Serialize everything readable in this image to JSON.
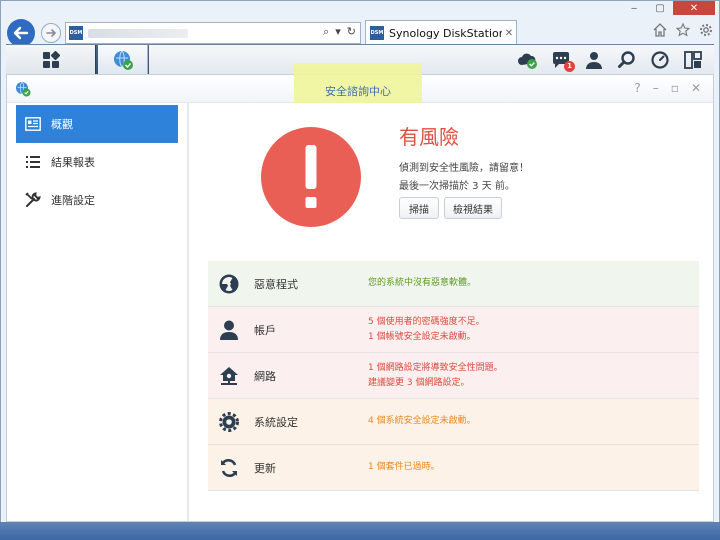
{
  "browser": {
    "tab_title": "Synology DiskStation - Sy...",
    "tab_close": "✕",
    "favicon_text": "DSM",
    "addr_tools": [
      "⌕",
      "▾",
      "↻"
    ],
    "caption": [
      "‒",
      "▢",
      "✕"
    ]
  },
  "window": {
    "title": "安全諮詢中心",
    "controls": [
      "?",
      "–",
      "▫",
      "✕"
    ]
  },
  "taskbar": {
    "notification_count": "1"
  },
  "sidebar": {
    "items": [
      {
        "label": "概觀",
        "icon": "overview-icon",
        "active": true
      },
      {
        "label": "結果報表",
        "icon": "list-icon",
        "active": false
      },
      {
        "label": "進階設定",
        "icon": "tools-icon",
        "active": false
      }
    ]
  },
  "summary": {
    "status": "有風險",
    "line1": "偵測到安全性風險，請留意！",
    "line2": "最後一次掃描於 3 天 前。",
    "scan_label": "掃描",
    "results_label": "檢視結果"
  },
  "categories": [
    {
      "name": "惡意程式",
      "icon": "radiation-icon",
      "level": "ok",
      "lines": [
        "您的系統中沒有惡意軟體。"
      ]
    },
    {
      "name": "帳戶",
      "icon": "user-icon",
      "level": "danger",
      "lines": [
        "5 個使用者的密碼強度不足。",
        "1 個帳號安全設定未啟動。"
      ]
    },
    {
      "name": "網路",
      "icon": "network-icon",
      "level": "danger",
      "lines": [
        "1 個網路設定將導致安全性問題。",
        "建議變更 3 個網路設定。"
      ]
    },
    {
      "name": "系統設定",
      "icon": "gear-icon",
      "level": "warn",
      "lines": [
        "4 個系統安全設定未啟動。"
      ]
    },
    {
      "name": "更新",
      "icon": "refresh-icon",
      "level": "warn",
      "lines": [
        "1 個套件已過時。"
      ]
    }
  ],
  "colors": {
    "accent": "#2e82d9",
    "danger": "#de4a3e",
    "ok": "#5e9b1f",
    "warn": "#e98a1e",
    "alert_circle": "#ea5f55"
  }
}
